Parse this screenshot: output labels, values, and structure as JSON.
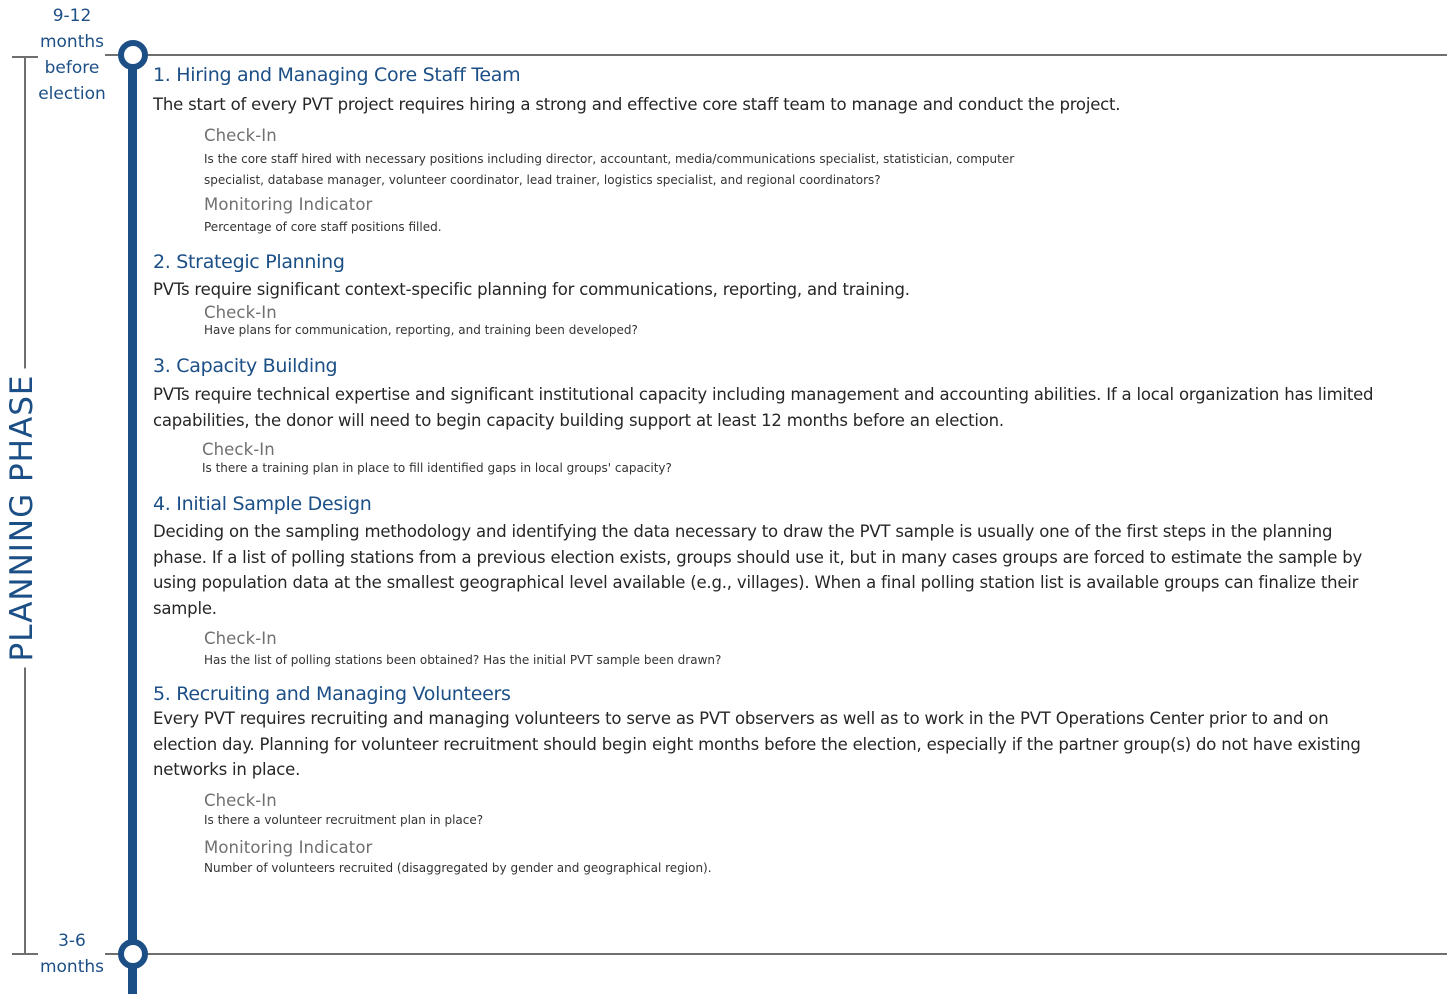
{
  "timeline": {
    "start_label": [
      "9-12",
      "months",
      "before",
      "election"
    ],
    "end_label": [
      "3-6",
      "months"
    ],
    "phase": "PLANNING PHASE"
  },
  "sections": [
    {
      "title": "1. Hiring and Managing Core Staff Team",
      "body": "The start of every PVT project requires hiring a strong and effective core staff team to manage and conduct the project.",
      "checkin_heading": "Check-In",
      "checkin_lines": [
        "Is the core staff hired with necessary positions including director, accountant, media/communications specialist, statistician, computer",
        "specialist, database manager, volunteer coordinator, lead trainer, logistics specialist, and regional coordinators?"
      ],
      "indicator_heading": "Monitoring Indicator",
      "indicator_text": "Percentage of core staff positions filled."
    },
    {
      "title": "2. Strategic Planning",
      "body": "PVTs require significant context-specific planning for communications, reporting, and training.",
      "checkin_heading": "Check-In",
      "checkin_text": "Have plans for communication, reporting, and training been developed?"
    },
    {
      "title": "3. Capacity Building",
      "body_lines": [
        "PVTs require technical expertise and significant institutional capacity including management and accounting abilities. If a local organization has limited",
        "capabilities, the donor will need to begin capacity building support at least 12 months before an election."
      ],
      "checkin_heading": "Check-In",
      "checkin_text": "Is there a training plan in place to fill identified gaps in local groups' capacity?"
    },
    {
      "title": "4. Initial Sample Design",
      "body_lines": [
        "Deciding on the sampling methodology and identifying the data necessary to draw the PVT sample is usually one of the first steps in the planning",
        "phase. If a list of polling stations from a previous election exists, groups should use it, but in many cases groups are forced to estimate the sample by",
        "using population data at the smallest geographical level available (e.g., villages). When a final polling station list is available groups can finalize their",
        "sample."
      ],
      "checkin_heading": "Check-In",
      "checkin_text": "Has the list of polling stations been obtained? Has the initial PVT sample been drawn?"
    },
    {
      "title": "5.  Recruiting and Managing Volunteers",
      "body_lines": [
        "Every PVT requires recruiting and managing volunteers to serve as PVT observers as well as to work in the PVT Operations Center prior to and on",
        "election day. Planning for volunteer recruitment should begin eight months before the election, especially if the partner group(s) do not have existing",
        "networks in place."
      ],
      "checkin_heading": "Check-In",
      "checkin_text": "Is there a volunteer recruitment plan in place?",
      "indicator_heading": "Monitoring Indicator",
      "indicator_text": "Number of volunteers recruited (disaggregated by gender and geographical region)."
    }
  ],
  "colors": {
    "accent": "#1c4f86",
    "rule": "#6f6f6f",
    "subheading": "#707070"
  }
}
